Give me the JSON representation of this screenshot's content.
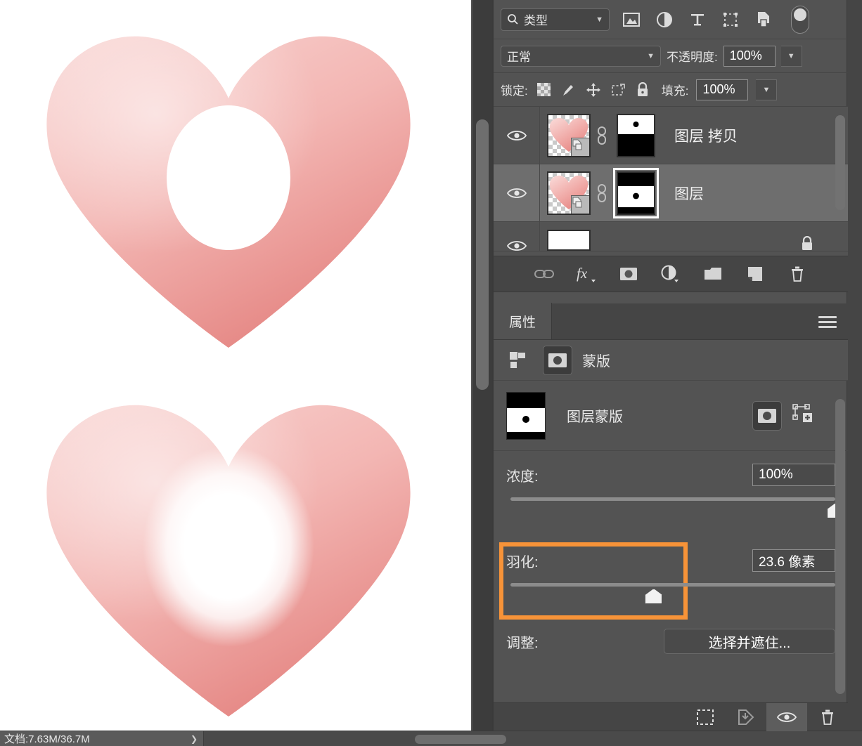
{
  "app": {
    "name": "Photoshop"
  },
  "canvas": {
    "heart_top": {
      "label": "heart-sharp-mask",
      "fill_start": "#f5c4c2",
      "fill_end": "#e8928e",
      "hole": "white-ellipse-sharp"
    },
    "heart_bottom": {
      "label": "heart-feathered-mask",
      "fill_start": "#f5c4c2",
      "fill_end": "#e8928e",
      "hole": "white-ellipse-feathered"
    },
    "background": "#ffffff"
  },
  "statusbar": {
    "doc_info": "文档:7.63M/36.7M",
    "chevron": "chevron-right-icon"
  },
  "layers_panel": {
    "filter": {
      "kind_label": "类型",
      "search_icon": "search-icon",
      "chevron": "chevron-down-icon",
      "icons": [
        "image-filter-icon",
        "adjustment-filter-icon",
        "text-filter-icon",
        "shape-filter-icon",
        "smart-object-filter-icon"
      ],
      "toggle": "filter-enable-toggle"
    },
    "blend": {
      "mode": "正常",
      "opacity_label": "不透明度:",
      "opacity_value": "100%"
    },
    "lock": {
      "label": "锁定:",
      "icons": [
        "transparent-pixels-lock-icon",
        "image-pixels-lock-icon",
        "position-lock-icon",
        "artboard-nesting-lock-icon",
        "lock-all-icon"
      ],
      "fill_label": "填充:",
      "fill_value": "100%"
    },
    "rows": [
      {
        "name": "图层 拷贝",
        "visible_icon": "eye-icon",
        "link_icon": "link-chain-icon",
        "thumbnail": "heart-thumbnail",
        "smart_object_badge": "smart-object-icon",
        "mask_thumbnail": "mask-white-top-black-bottom",
        "selected": false,
        "mask_selected": false
      },
      {
        "name": "图层",
        "visible_icon": "eye-icon",
        "link_icon": "link-chain-icon",
        "thumbnail": "heart-thumbnail",
        "smart_object_badge": "smart-object-icon",
        "mask_thumbnail": "mask-black-white-black",
        "selected": true,
        "mask_selected": true
      }
    ],
    "toolbar_icons": [
      "link-layers-icon",
      "layer-style-fx-icon",
      "add-layer-mask-icon",
      "new-adjustment-layer-icon",
      "new-group-icon",
      "new-layer-icon",
      "delete-layer-icon"
    ]
  },
  "properties_panel": {
    "tab_label": "属性",
    "menu_icon": "panel-menu-icon",
    "kind_row": {
      "thumb_icon": "layer-thumb-icon",
      "mask_icon": "mask-icon",
      "label": "蒙版"
    },
    "mask_row": {
      "label": "图层蒙版",
      "thumbnail": "mask-black-white-black",
      "pixel_mask_icon": "pixel-mask-icon",
      "vector_mask_icon": "add-vector-mask-icon"
    },
    "density": {
      "label": "浓度:",
      "value": "100%",
      "percent": 100
    },
    "feather": {
      "label": "羽化:",
      "value": "23.6 像素",
      "percent": 44,
      "highlighted": true,
      "highlight_color": "#f79338"
    },
    "adjust": {
      "label": "调整:",
      "button_label": "选择并遮住..."
    },
    "footer_icons": [
      "load-selection-from-mask-icon",
      "apply-mask-icon",
      "toggle-mask-icon",
      "delete-mask-icon"
    ]
  }
}
